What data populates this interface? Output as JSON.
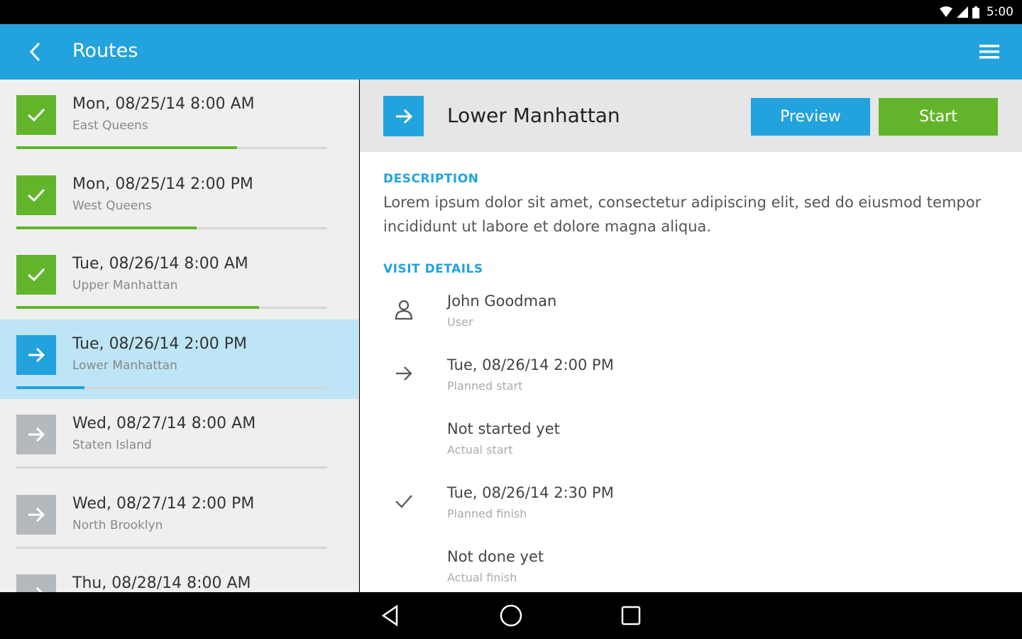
{
  "status_bar": {
    "time": "5:00",
    "icons": [
      "wifi-icon",
      "signal-icon",
      "battery-icon"
    ]
  },
  "app_bar": {
    "title": "Routes",
    "back_icon": "chevron-left-icon",
    "menu_icon": "hamburger-menu-icon"
  },
  "colors": {
    "primary": "#22a3dd",
    "success": "#62b52a",
    "pending": "#b4b9bd",
    "selected_row": "#bde5f5"
  },
  "routes": [
    {
      "date": "Mon, 08/25/14  8:00 AM",
      "area": "East Queens",
      "status": "done",
      "progress": 0.71
    },
    {
      "date": "Mon, 08/25/14  2:00 PM",
      "area": "West Queens",
      "status": "done",
      "progress": 0.58
    },
    {
      "date": "Tue, 08/26/14  8:00 AM",
      "area": "Upper Manhattan",
      "status": "done",
      "progress": 0.78
    },
    {
      "date": "Tue, 08/26/14  2:00 PM",
      "area": "Lower Manhattan",
      "status": "active",
      "progress": 0.22
    },
    {
      "date": "Wed, 08/27/14  8:00 AM",
      "area": "Staten Island",
      "status": "pending",
      "progress": 0
    },
    {
      "date": "Wed, 08/27/14  2:00 PM",
      "area": "North Brooklyn",
      "status": "pending",
      "progress": 0
    },
    {
      "date": "Thu, 08/28/14  8:00 AM",
      "area": "",
      "status": "pending",
      "progress": 0
    }
  ],
  "detail": {
    "title": "Lower Manhattan",
    "preview_label": "Preview",
    "start_label": "Start",
    "description_label": "DESCRIPTION",
    "description": "Lorem ipsum dolor sit amet, consectetur adipiscing elit, sed do eiusmod tempor incididunt ut labore et dolore magna aliqua.",
    "visit_details_label": "VISIT DETAILS",
    "visit_details": [
      {
        "icon": "user-icon",
        "value": "John Goodman",
        "caption": "User"
      },
      {
        "icon": "arrow-right-icon",
        "value": "Tue, 08/26/14  2:00 PM",
        "caption": "Planned start"
      },
      {
        "icon": "",
        "value": "Not started yet",
        "caption": "Actual start"
      },
      {
        "icon": "checkmark-icon",
        "value": "Tue, 08/26/14  2:30 PM",
        "caption": "Planned finish"
      },
      {
        "icon": "",
        "value": "Not done yet",
        "caption": "Actual finish"
      }
    ]
  },
  "nav_bar": {
    "buttons": [
      "back-triangle-icon",
      "home-circle-icon",
      "recents-square-icon"
    ]
  }
}
